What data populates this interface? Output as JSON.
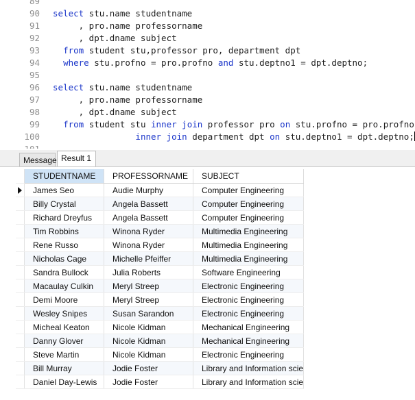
{
  "editor": {
    "lines": [
      {
        "n": "89",
        "segs": [
          {
            "t": "",
            "k": false
          }
        ]
      },
      {
        "n": "90",
        "segs": [
          {
            "t": "select",
            "k": true
          },
          {
            "t": " stu.name studentname",
            "k": false
          }
        ]
      },
      {
        "n": "91",
        "segs": [
          {
            "t": "     , pro.name professorname",
            "k": false
          }
        ]
      },
      {
        "n": "92",
        "segs": [
          {
            "t": "     , dpt.dname subject",
            "k": false
          }
        ]
      },
      {
        "n": "93",
        "segs": [
          {
            "t": "  ",
            "k": false
          },
          {
            "t": "from",
            "k": true
          },
          {
            "t": " student stu,professor pro, department dpt",
            "k": false
          }
        ]
      },
      {
        "n": "94",
        "segs": [
          {
            "t": "  ",
            "k": false
          },
          {
            "t": "where",
            "k": true
          },
          {
            "t": " stu.profno = pro.profno ",
            "k": false
          },
          {
            "t": "and",
            "k": true
          },
          {
            "t": " stu.deptno1 = dpt.deptno;",
            "k": false
          }
        ]
      },
      {
        "n": "95",
        "segs": [
          {
            "t": "",
            "k": false
          }
        ]
      },
      {
        "n": "96",
        "segs": [
          {
            "t": "select",
            "k": true
          },
          {
            "t": " stu.name studentname",
            "k": false
          }
        ]
      },
      {
        "n": "97",
        "segs": [
          {
            "t": "     , pro.name professorname",
            "k": false
          }
        ]
      },
      {
        "n": "98",
        "segs": [
          {
            "t": "     , dpt.dname subject",
            "k": false
          }
        ]
      },
      {
        "n": "99",
        "segs": [
          {
            "t": "  ",
            "k": false
          },
          {
            "t": "from",
            "k": true
          },
          {
            "t": " student stu ",
            "k": false
          },
          {
            "t": "inner join",
            "k": true
          },
          {
            "t": " professor pro ",
            "k": false
          },
          {
            "t": "on",
            "k": true
          },
          {
            "t": " stu.profno = pro.profno",
            "k": false
          }
        ]
      },
      {
        "n": "100",
        "segs": [
          {
            "t": "                ",
            "k": false
          },
          {
            "t": "inner join",
            "k": true
          },
          {
            "t": " department dpt ",
            "k": false
          },
          {
            "t": "on",
            "k": true
          },
          {
            "t": " stu.deptno1 = dpt.deptno;",
            "k": false
          }
        ]
      },
      {
        "n": "101",
        "segs": [
          {
            "t": "",
            "k": false
          }
        ]
      }
    ]
  },
  "tabs": {
    "message": "Message",
    "result": "Result 1"
  },
  "grid": {
    "columns": [
      "STUDENTNAME",
      "PROFESSORNAME",
      "SUBJECT"
    ],
    "rows": [
      [
        "James Seo",
        "Audie Murphy",
        "Computer Engineering"
      ],
      [
        "Billy Crystal",
        "Angela Bassett",
        "Computer Engineering"
      ],
      [
        "Richard Dreyfus",
        "Angela Bassett",
        "Computer Engineering"
      ],
      [
        "Tim Robbins",
        "Winona Ryder",
        "Multimedia Engineering"
      ],
      [
        "Rene Russo",
        "Winona Ryder",
        "Multimedia Engineering"
      ],
      [
        "Nicholas Cage",
        "Michelle Pfeiffer",
        "Multimedia Engineering"
      ],
      [
        "Sandra Bullock",
        "Julia Roberts",
        "Software Engineering"
      ],
      [
        "Macaulay Culkin",
        "Meryl Streep",
        "Electronic Engineering"
      ],
      [
        "Demi Moore",
        "Meryl Streep",
        "Electronic Engineering"
      ],
      [
        "Wesley Snipes",
        "Susan Sarandon",
        "Electronic Engineering"
      ],
      [
        "Micheal Keaton",
        "Nicole Kidman",
        "Mechanical Engineering"
      ],
      [
        "Danny Glover",
        "Nicole Kidman",
        "Mechanical Engineering"
      ],
      [
        "Steve Martin",
        "Nicole Kidman",
        "Electronic Engineering"
      ],
      [
        "Bill Murray",
        "Jodie Foster",
        "Library and Information scie"
      ],
      [
        "Daniel Day-Lewis",
        "Jodie Foster",
        "Library and Information scie"
      ]
    ]
  }
}
